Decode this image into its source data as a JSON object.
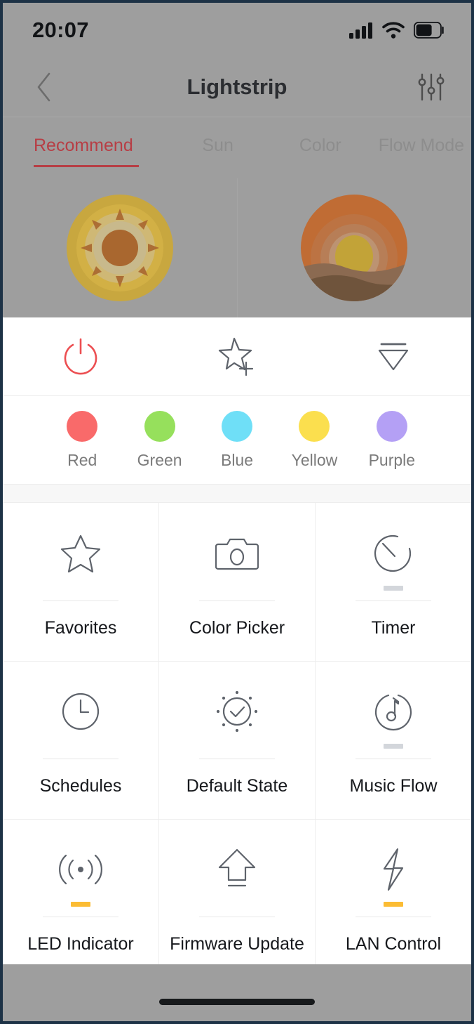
{
  "status_bar": {
    "time": "20:07",
    "icons": [
      "cellular-signal-icon",
      "wifi-icon",
      "battery-icon"
    ],
    "battery_level_pct": 62
  },
  "header": {
    "title": "Lightstrip",
    "back_icon": "chevron-left-icon",
    "settings_icon": "sliders-icon"
  },
  "tabs": {
    "active_index": 0,
    "items": [
      {
        "label": "Recommend"
      },
      {
        "label": "Sun"
      },
      {
        "label": "Color"
      },
      {
        "label": "Flow Mode"
      }
    ]
  },
  "scenes": [
    {
      "name": "sun-scene",
      "icon": "sun-icon"
    },
    {
      "name": "sunset-scene",
      "icon": "sunset-icon"
    }
  ],
  "actions": [
    {
      "label": "power",
      "icon": "power-icon",
      "color": "#ec4f52"
    },
    {
      "label": "add-favorite",
      "icon": "star-plus-icon",
      "color": "#5e636b"
    },
    {
      "label": "brightness",
      "icon": "brightness-triangle-icon",
      "color": "#5e636b"
    }
  ],
  "colors": [
    {
      "label": "Red",
      "hex": "#f96a6a"
    },
    {
      "label": "Green",
      "hex": "#96e05c"
    },
    {
      "label": "Blue",
      "hex": "#6fdff7"
    },
    {
      "label": "Yellow",
      "hex": "#fbdf4e"
    },
    {
      "label": "Purple",
      "hex": "#b4a0f5"
    }
  ],
  "features": [
    [
      {
        "label": "Favorites",
        "icon": "star-icon",
        "dash": "none"
      },
      {
        "label": "Color Picker",
        "icon": "camera-icon",
        "dash": "none"
      },
      {
        "label": "Timer",
        "icon": "timer-icon",
        "dash": "gray"
      }
    ],
    [
      {
        "label": "Schedules",
        "icon": "clock-icon",
        "dash": "none"
      },
      {
        "label": "Default State",
        "icon": "check-sun-icon",
        "dash": "none"
      },
      {
        "label": "Music Flow",
        "icon": "music-note-icon",
        "dash": "gray"
      }
    ],
    [
      {
        "label": "LED Indicator",
        "icon": "signal-waves-icon",
        "dash": "orange"
      },
      {
        "label": "Firmware Update",
        "icon": "upload-arrow-icon",
        "dash": "none"
      },
      {
        "label": "LAN Control",
        "icon": "lightning-bolt-icon",
        "dash": "orange"
      }
    ]
  ],
  "bottom_bar": {
    "home_indicator": "home-indicator"
  },
  "theme": {
    "accent_red": "#b73e45",
    "power_red": "#ec4f52",
    "dash_orange": "#fbbc34",
    "dash_gray": "#d3d6db",
    "dim_overlay": "#9e9e9e",
    "icon_stroke": "#5e636b"
  }
}
